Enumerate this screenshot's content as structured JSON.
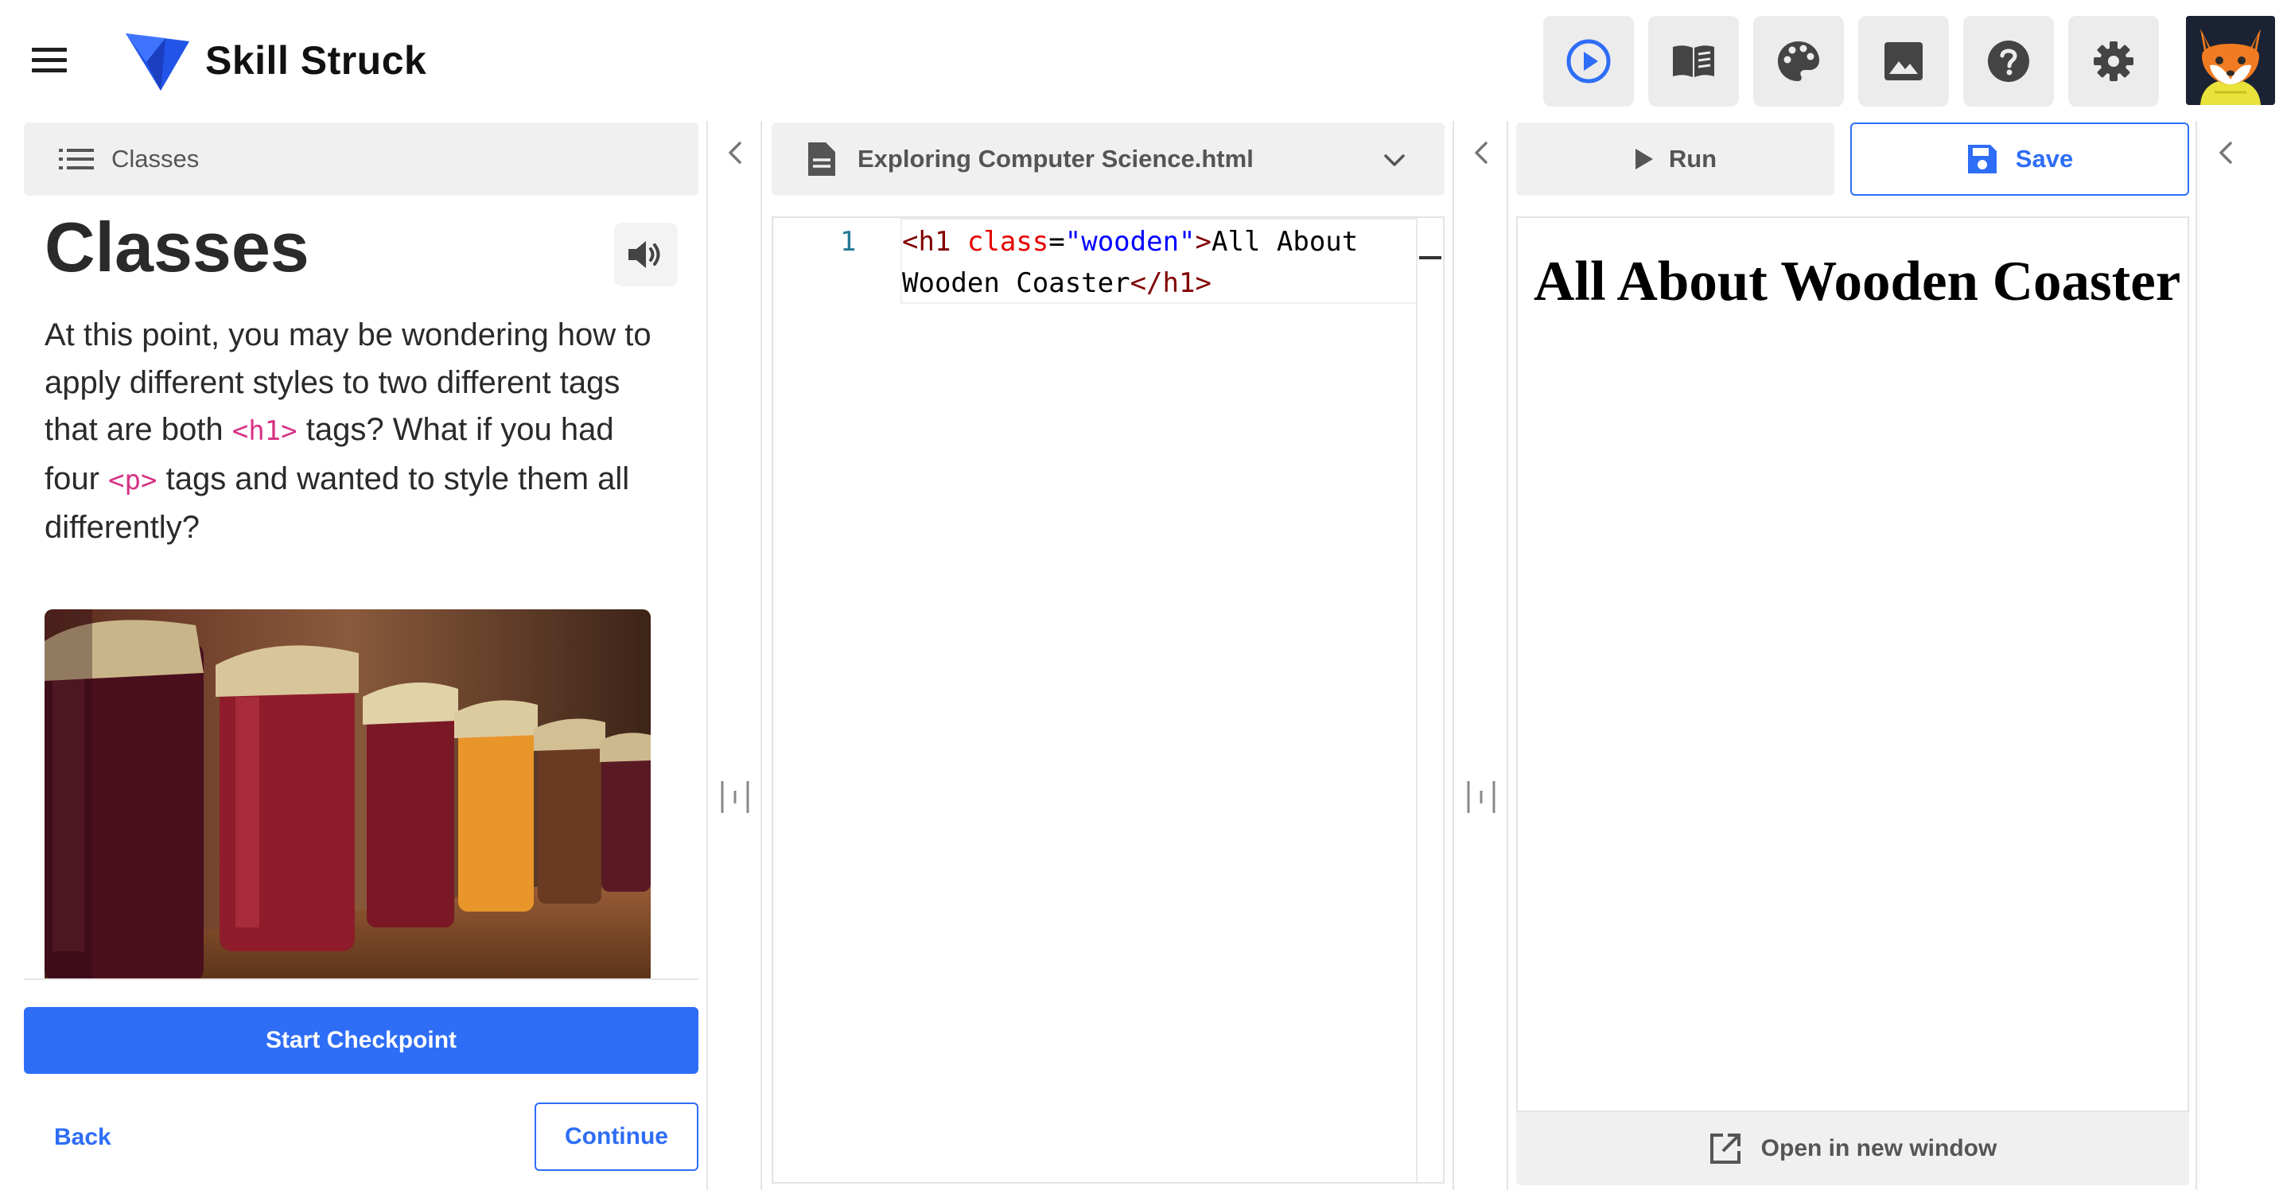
{
  "header": {
    "brand": "Skill Struck",
    "buttons": [
      {
        "name": "run-preview",
        "icon": "play-circle-icon"
      },
      {
        "name": "reference",
        "icon": "book-icon"
      },
      {
        "name": "theme",
        "icon": "palette-icon"
      },
      {
        "name": "images",
        "icon": "image-icon"
      },
      {
        "name": "help",
        "icon": "help-icon"
      },
      {
        "name": "settings",
        "icon": "gear-icon"
      }
    ],
    "accent_color": "#2e6df6"
  },
  "lesson": {
    "tab_label": "Classes",
    "title": "Classes",
    "body_parts": {
      "p1": "At this point, you may be wondering how to apply different styles to two different tags that are both ",
      "tag1": "<h1>",
      "p2": " tags? What if you had four ",
      "tag2": "<p>",
      "p3": " tags and wanted to style them all differently?"
    },
    "start_checkpoint": "Start Checkpoint",
    "back": "Back",
    "continue": "Continue"
  },
  "editor": {
    "file_name": "Exploring Computer Science.html",
    "line_number": "1",
    "code_tokens": {
      "open_bracket": "<",
      "tag_name": "h1",
      "space": " ",
      "attr_name": "class",
      "equals": "=",
      "attr_value": "\"wooden\"",
      "open_close": ">",
      "text": "All About Wooden Coaster",
      "close_tag_open": "</",
      "close_tag_name": "h1",
      "close_tag_end": ">"
    }
  },
  "preview": {
    "run_label": "Run",
    "save_label": "Save",
    "heading": "All About Wooden Coaster",
    "open_new_window": "Open in new window"
  }
}
